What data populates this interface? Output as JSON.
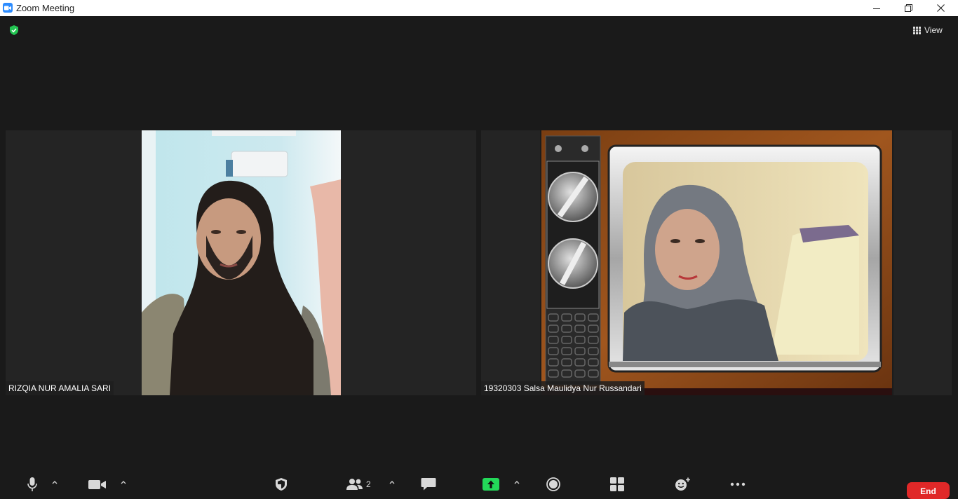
{
  "window": {
    "title": "Zoom Meeting"
  },
  "header": {
    "view_label": "View"
  },
  "participants": [
    {
      "name": "RIZQIA NUR AMALIA SARI"
    },
    {
      "name": "19320303 Salsa Maulidya Nur Russandari"
    }
  ],
  "toolbar": {
    "participant_count": "2",
    "end_label": "End"
  },
  "colors": {
    "accent_blue": "#2d8cff",
    "end_red": "#e02828",
    "share_green": "#23d959",
    "encryption_green": "#23c552",
    "stage_bg": "#1a1a1a"
  }
}
